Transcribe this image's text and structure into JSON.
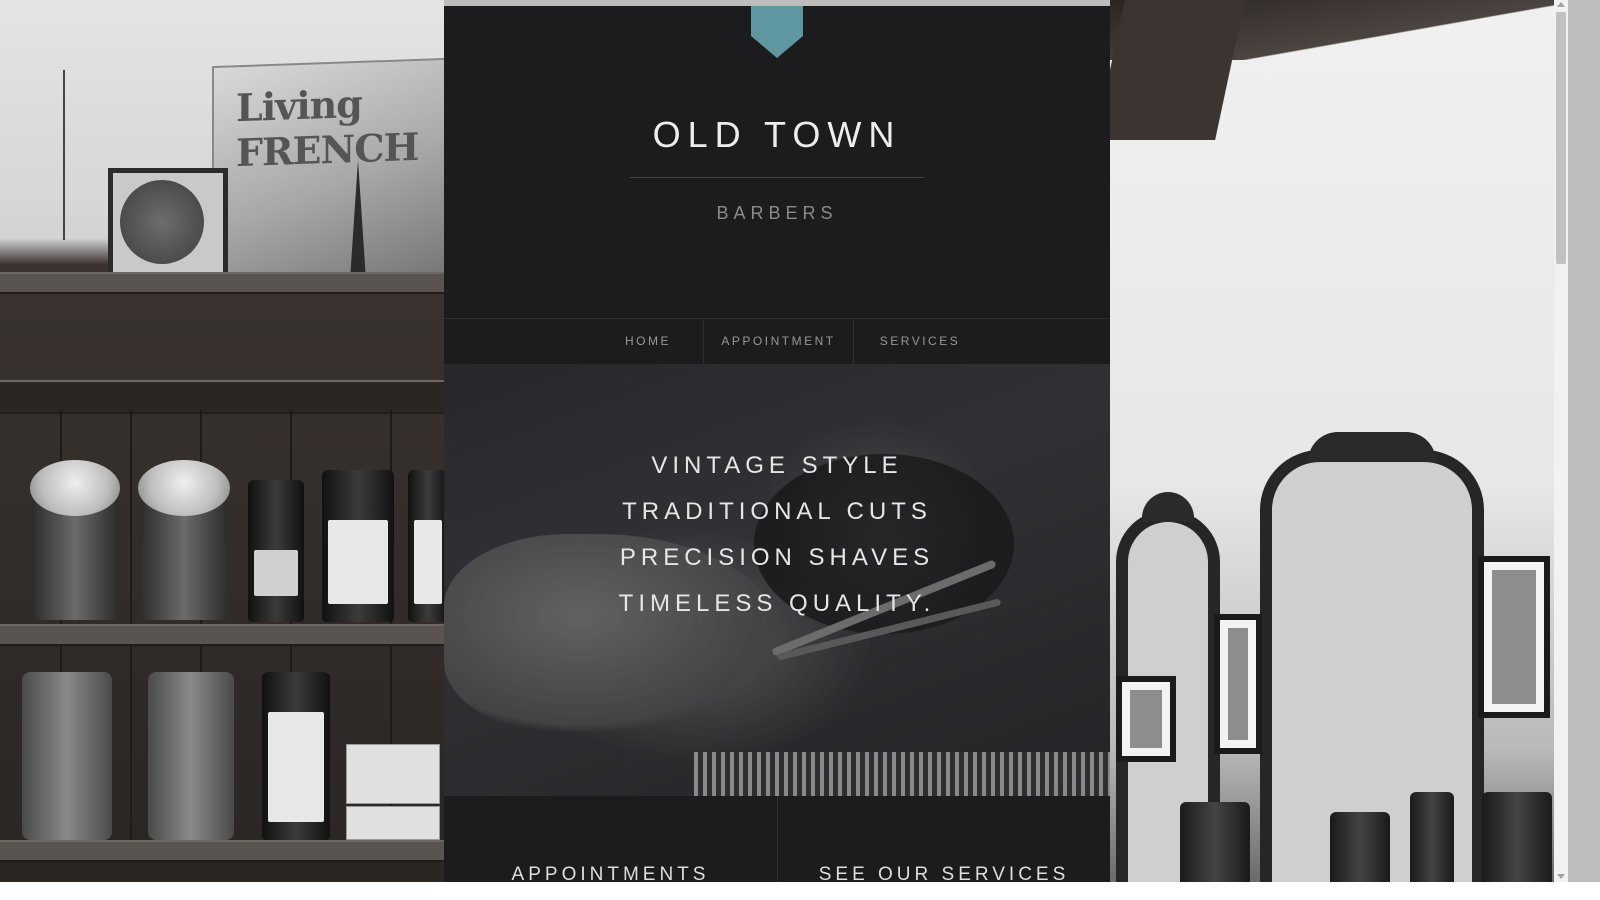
{
  "header": {
    "title": "OLD TOWN",
    "subtitle": "BARBERS"
  },
  "nav": {
    "items": [
      {
        "label": "HOME"
      },
      {
        "label": "APPOINTMENT"
      },
      {
        "label": "SERVICES"
      }
    ]
  },
  "hero": {
    "lines": [
      "VINTAGE STYLE",
      "TRADITIONAL CUTS",
      "PRECISION SHAVES",
      "TIMELESS QUALITY."
    ]
  },
  "cards": [
    {
      "title": "APPOINTMENTS"
    },
    {
      "title": "SEE OUR SERVICES"
    }
  ],
  "background": {
    "sign_text": "Living FRENCH"
  },
  "colors": {
    "panel": "#1c1c1f",
    "ribbon_accent": "#5f97a0",
    "title_text": "#ededed",
    "subtitle_text": "#8b8b8f",
    "nav_text": "#97979b"
  },
  "icons": {
    "ribbon": "bookmark-ribbon-icon"
  }
}
